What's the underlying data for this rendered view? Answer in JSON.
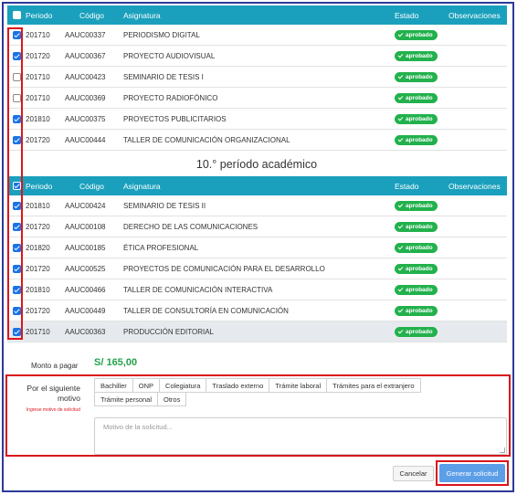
{
  "columns": {
    "periodo": "Periodo",
    "codigo": "Código",
    "asignatura": "Asignatura",
    "estado": "Estado",
    "observaciones": "Observaciones"
  },
  "table1": {
    "header_checked": false,
    "rows": [
      {
        "checked": true,
        "periodo": "201710",
        "codigo": "AAUC00337",
        "asignatura": "PERIODISMO DIGITAL",
        "estado": "aprobado"
      },
      {
        "checked": true,
        "periodo": "201720",
        "codigo": "AAUC00367",
        "asignatura": "PROYECTO AUDIOVISUAL",
        "estado": "aprobado"
      },
      {
        "checked": false,
        "periodo": "201710",
        "codigo": "AAUC00423",
        "asignatura": "SEMINARIO DE TESIS I",
        "estado": "aprobado"
      },
      {
        "checked": false,
        "periodo": "201710",
        "codigo": "AAUC00369",
        "asignatura": "PROYECTO RADIOFÓNICO",
        "estado": "aprobado"
      },
      {
        "checked": true,
        "periodo": "201810",
        "codigo": "AAUC00375",
        "asignatura": "PROYECTOS PUBLICITARIOS",
        "estado": "aprobado"
      },
      {
        "checked": true,
        "periodo": "201720",
        "codigo": "AAUC00444",
        "asignatura": "TALLER DE COMUNICACIÓN ORGANIZACIONAL",
        "estado": "aprobado"
      }
    ]
  },
  "section_title": "10.° período académico",
  "table2": {
    "header_checked": true,
    "rows": [
      {
        "checked": true,
        "periodo": "201810",
        "codigo": "AAUC00424",
        "asignatura": "SEMINARIO DE TESIS II",
        "estado": "aprobado"
      },
      {
        "checked": true,
        "periodo": "201720",
        "codigo": "AAUC00108",
        "asignatura": "DERECHO DE LAS COMUNICACIONES",
        "estado": "aprobado"
      },
      {
        "checked": true,
        "periodo": "201820",
        "codigo": "AAUC00185",
        "asignatura": "ÉTICA PROFESIONAL",
        "estado": "aprobado"
      },
      {
        "checked": true,
        "periodo": "201720",
        "codigo": "AAUC00525",
        "asignatura": "PROYECTOS DE COMUNICACIÓN PARA EL DESARROLLO",
        "estado": "aprobado"
      },
      {
        "checked": true,
        "periodo": "201810",
        "codigo": "AAUC00466",
        "asignatura": "TALLER DE COMUNICACIÓN INTERACTIVA",
        "estado": "aprobado"
      },
      {
        "checked": true,
        "periodo": "201720",
        "codigo": "AAUC00449",
        "asignatura": "TALLER DE CONSULTORÍA EN COMUNICACIÓN",
        "estado": "aprobado"
      },
      {
        "checked": true,
        "periodo": "201710",
        "codigo": "AAUC00363",
        "asignatura": "PRODUCCIÓN EDITORIAL",
        "estado": "aprobado",
        "highlight": true
      }
    ]
  },
  "monto": {
    "label": "Monto a pagar",
    "value": "S/ 165,00"
  },
  "motivo": {
    "label": "Por el siguiente motivo",
    "error": "Ingrese motivo de solicitud",
    "options": [
      "Bachiller",
      "ONP",
      "Colegiatura",
      "Traslado externo",
      "Trámite laboral",
      "Trámites para el extranjero",
      "Trámite personal",
      "Otros"
    ],
    "placeholder": "Motivo de la solicitud..."
  },
  "buttons": {
    "cancel": "Cancelar",
    "submit": "Generar solicitud"
  },
  "colors": {
    "header": "#1aa0bd",
    "approved": "#22b14c",
    "primary": "#5c9fe8",
    "highlight_box": "#d9161c",
    "frame": "#2c3a9a"
  }
}
